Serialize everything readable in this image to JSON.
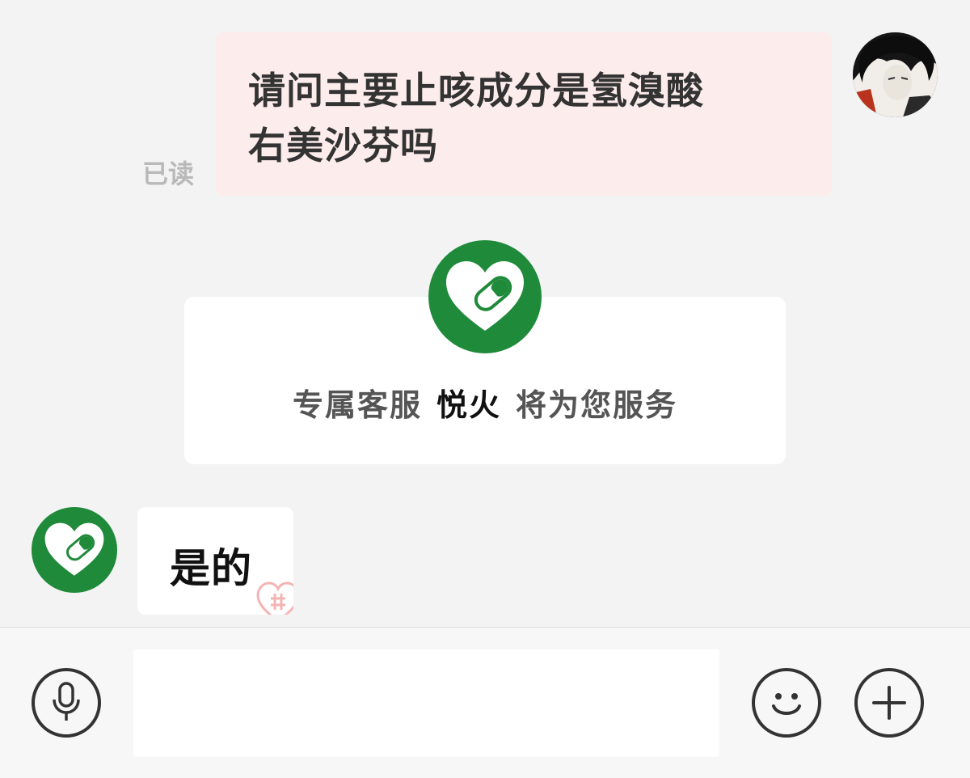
{
  "conversation": {
    "user_message": {
      "line1": "请问主要止咳成分是氢溴酸",
      "line2": "右美沙芬吗",
      "read_status": "已读"
    },
    "service_card": {
      "prefix": "专属客服",
      "agent_name": "悦火",
      "suffix": "将为您服务"
    },
    "agent_message": {
      "text": "是的"
    }
  },
  "input_bar": {
    "input_value": "",
    "voice_icon": "microphone-icon",
    "emoji_icon": "smiley-icon",
    "more_icon": "plus-icon"
  },
  "colors": {
    "user_bubble": "#fdecec",
    "brand_green": "#1f8a3a",
    "background": "#f3f3f3"
  }
}
